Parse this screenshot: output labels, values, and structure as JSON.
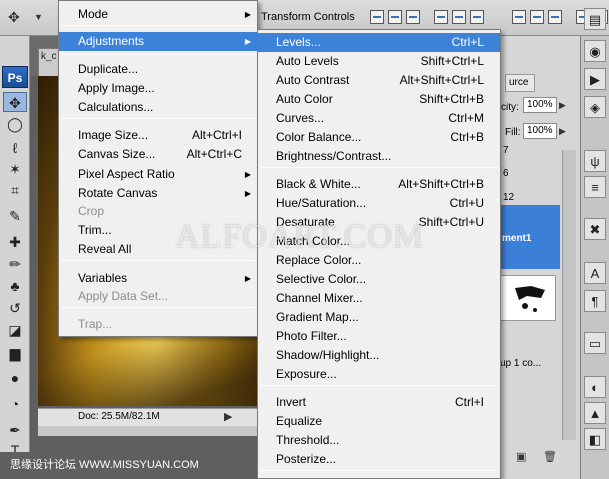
{
  "options_bar": {
    "transform_controls_label": "Transform Controls"
  },
  "tools": {
    "ps_logo": "Ps",
    "items": [
      {
        "name": "move-tool",
        "glyph": "✥"
      },
      {
        "name": "marquee-tool",
        "glyph": "◯"
      },
      {
        "name": "lasso-tool",
        "glyph": "ℓ"
      },
      {
        "name": "magic-wand-tool",
        "glyph": "✶"
      },
      {
        "name": "crop-tool",
        "glyph": "⌗"
      },
      {
        "name": "eyedropper-tool",
        "glyph": "✎"
      },
      {
        "name": "healing-brush-tool",
        "glyph": "✚"
      },
      {
        "name": "brush-tool",
        "glyph": "✏"
      },
      {
        "name": "clone-stamp-tool",
        "glyph": "♣"
      },
      {
        "name": "history-brush-tool",
        "glyph": "↺"
      },
      {
        "name": "eraser-tool",
        "glyph": "◪"
      },
      {
        "name": "gradient-tool",
        "glyph": "▆"
      },
      {
        "name": "blur-tool",
        "glyph": "●"
      },
      {
        "name": "dodge-tool",
        "glyph": "◔"
      },
      {
        "name": "pen-tool",
        "glyph": "✒"
      },
      {
        "name": "type-tool",
        "glyph": "T"
      }
    ]
  },
  "document": {
    "tab_text": "k_c",
    "doc_size": "Doc: 25.5M/82.1M"
  },
  "watermark": {
    "center": "ALFOART.COM",
    "left": "思缘设计论坛  WWW.MISSYUAN.COM"
  },
  "layers_panel": {
    "tab_label": "urce",
    "opacity_label": "city:",
    "opacity_value": "100%",
    "fill_label": "Fill:",
    "fill_value": "100%",
    "row_number_a": "7",
    "row_number_b": "6",
    "row_number_c": "12",
    "selected_layer_name": "ment1",
    "group_layer_name": "up 1 co..."
  },
  "image_menu": {
    "items": [
      {
        "label": "Mode",
        "shortcut": "",
        "submenu": true,
        "disabled": false,
        "selected": false
      },
      {
        "label": "Adjustments",
        "shortcut": "",
        "submenu": true,
        "disabled": false,
        "selected": true
      },
      {
        "label": "Duplicate...",
        "shortcut": "",
        "submenu": false,
        "disabled": false,
        "selected": false
      },
      {
        "label": "Apply Image...",
        "shortcut": "",
        "submenu": false,
        "disabled": false,
        "selected": false
      },
      {
        "label": "Calculations...",
        "shortcut": "",
        "submenu": false,
        "disabled": false,
        "selected": false
      },
      {
        "label": "Image Size...",
        "shortcut": "Alt+Ctrl+I",
        "submenu": false,
        "disabled": false,
        "selected": false
      },
      {
        "label": "Canvas Size...",
        "shortcut": "Alt+Ctrl+C",
        "submenu": false,
        "disabled": false,
        "selected": false
      },
      {
        "label": "Pixel Aspect Ratio",
        "shortcut": "",
        "submenu": true,
        "disabled": false,
        "selected": false
      },
      {
        "label": "Rotate Canvas",
        "shortcut": "",
        "submenu": true,
        "disabled": false,
        "selected": false
      },
      {
        "label": "Crop",
        "shortcut": "",
        "submenu": false,
        "disabled": true,
        "selected": false
      },
      {
        "label": "Trim...",
        "shortcut": "",
        "submenu": false,
        "disabled": false,
        "selected": false
      },
      {
        "label": "Reveal All",
        "shortcut": "",
        "submenu": false,
        "disabled": false,
        "selected": false
      },
      {
        "label": "Variables",
        "shortcut": "",
        "submenu": true,
        "disabled": false,
        "selected": false
      },
      {
        "label": "Apply Data Set...",
        "shortcut": "",
        "submenu": false,
        "disabled": true,
        "selected": false
      },
      {
        "label": "Trap...",
        "shortcut": "",
        "submenu": false,
        "disabled": true,
        "selected": false
      }
    ]
  },
  "adjustments_menu": {
    "items": [
      {
        "label": "Levels...",
        "shortcut": "Ctrl+L",
        "selected": true
      },
      {
        "label": "Auto Levels",
        "shortcut": "Shift+Ctrl+L",
        "selected": false
      },
      {
        "label": "Auto Contrast",
        "shortcut": "Alt+Shift+Ctrl+L",
        "selected": false
      },
      {
        "label": "Auto Color",
        "shortcut": "Shift+Ctrl+B",
        "selected": false
      },
      {
        "label": "Curves...",
        "shortcut": "Ctrl+M",
        "selected": false
      },
      {
        "label": "Color Balance...",
        "shortcut": "Ctrl+B",
        "selected": false
      },
      {
        "label": "Brightness/Contrast...",
        "shortcut": "",
        "selected": false
      },
      {
        "label": "Black & White...",
        "shortcut": "Alt+Shift+Ctrl+B",
        "selected": false
      },
      {
        "label": "Hue/Saturation...",
        "shortcut": "Ctrl+U",
        "selected": false
      },
      {
        "label": "Desaturate",
        "shortcut": "Shift+Ctrl+U",
        "selected": false
      },
      {
        "label": "Match Color...",
        "shortcut": "",
        "selected": false
      },
      {
        "label": "Replace Color...",
        "shortcut": "",
        "selected": false
      },
      {
        "label": "Selective Color...",
        "shortcut": "",
        "selected": false
      },
      {
        "label": "Channel Mixer...",
        "shortcut": "",
        "selected": false
      },
      {
        "label": "Gradient Map...",
        "shortcut": "",
        "selected": false
      },
      {
        "label": "Photo Filter...",
        "shortcut": "",
        "selected": false
      },
      {
        "label": "Shadow/Highlight...",
        "shortcut": "",
        "selected": false
      },
      {
        "label": "Exposure...",
        "shortcut": "",
        "selected": false
      },
      {
        "label": "Invert",
        "shortcut": "Ctrl+I",
        "selected": false
      },
      {
        "label": "Equalize",
        "shortcut": "",
        "selected": false
      },
      {
        "label": "Threshold...",
        "shortcut": "",
        "selected": false
      },
      {
        "label": "Posterize...",
        "shortcut": "",
        "selected": false
      }
    ]
  },
  "colors": {
    "menu_highlight": "#3d82d9",
    "layer_selected": "#3c7fd9",
    "canvas_gold": "#b88a1a"
  }
}
